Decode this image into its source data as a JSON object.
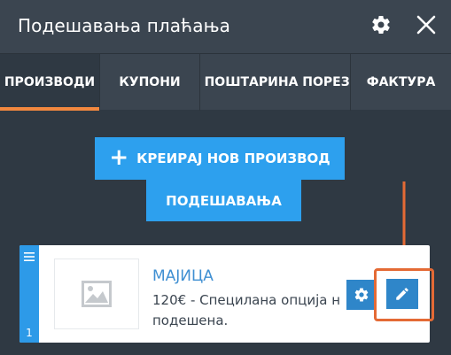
{
  "header": {
    "title": "Подешавања плаћања",
    "gear_icon": "gear-icon",
    "close_icon": "close-icon"
  },
  "tabs": [
    {
      "label": "ПРОИЗВОДИ",
      "active": true
    },
    {
      "label": "КУПОНИ",
      "active": false
    },
    {
      "label": "ПОШТАРИНА",
      "active": false
    },
    {
      "label": "ПОРЕЗ",
      "active": false
    },
    {
      "label": "ФАКТУРА",
      "active": false
    }
  ],
  "actions": {
    "create_label": "КРЕИРАЈ НОВ ПРОИЗВОД",
    "create_icon": "plus-icon",
    "settings_label": "ПОДЕШАВАЊА"
  },
  "product": {
    "index": "1",
    "name": "МАЈИЦА",
    "description": "120€ - Специлана опција н подешена.",
    "thumbnail_icon": "image-placeholder-icon",
    "settings_icon": "gear-icon",
    "edit_icon": "pencil-icon"
  },
  "colors": {
    "background": "#2f3943",
    "header": "#3b4550",
    "accent": "#2da0ee",
    "active_tab_underline": "#f2883f",
    "annotation": "#e46a35"
  }
}
